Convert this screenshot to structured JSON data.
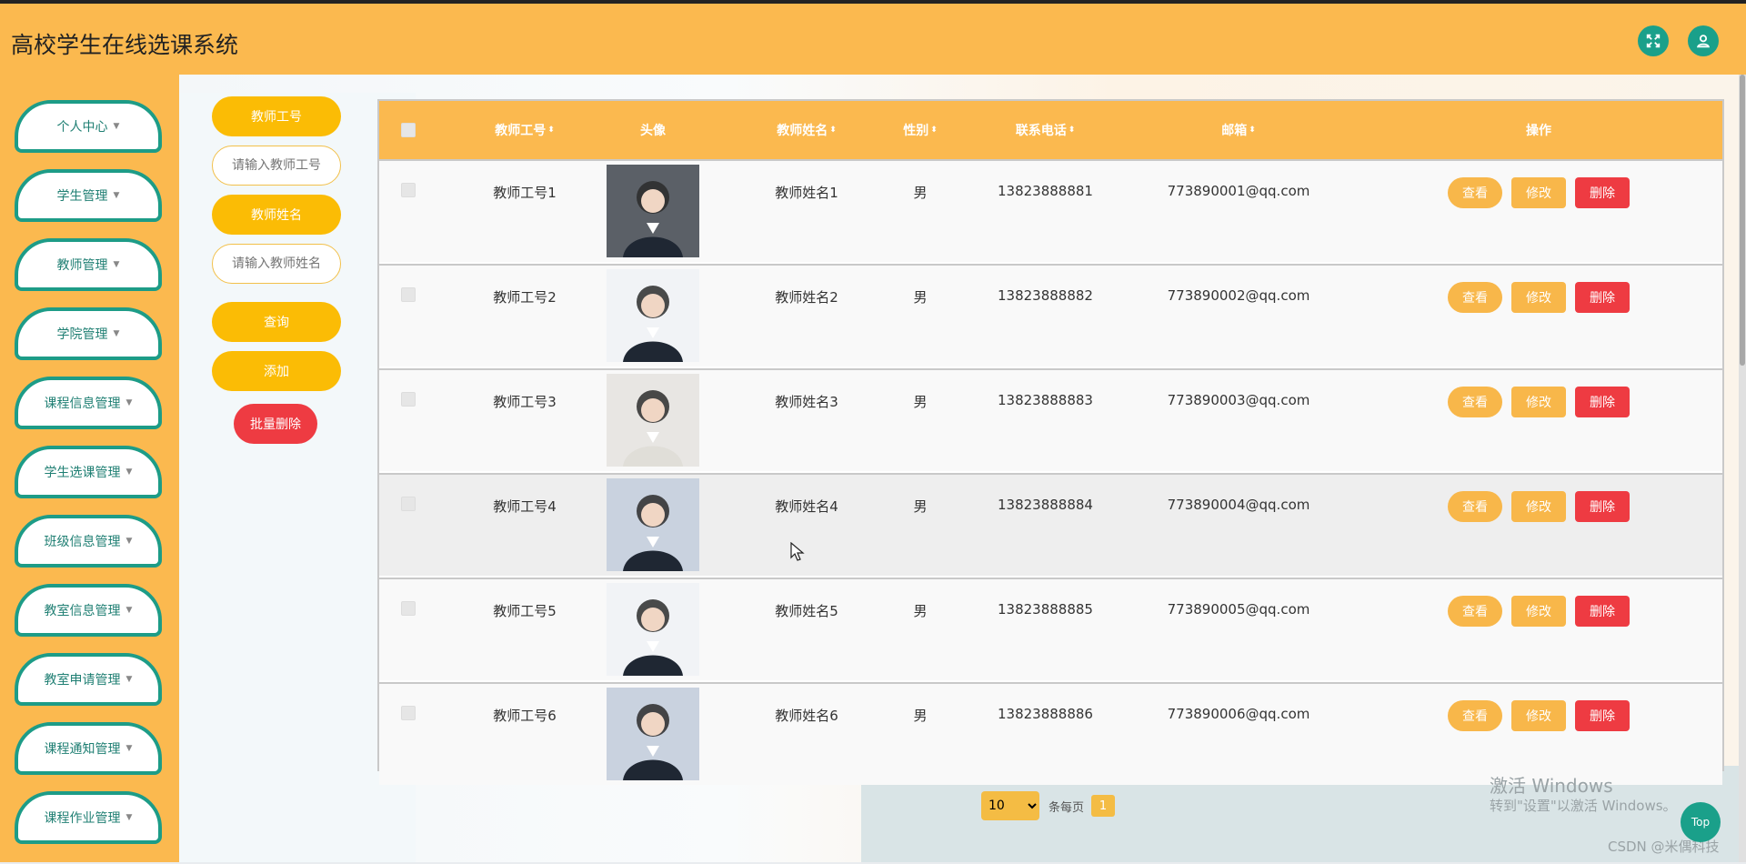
{
  "header": {
    "title": "高校学生在线选课系统",
    "fullscreen_icon": "expand-icon",
    "user_icon": "user-icon"
  },
  "sidebar": {
    "items": [
      {
        "label": "个人中心"
      },
      {
        "label": "学生管理"
      },
      {
        "label": "教师管理"
      },
      {
        "label": "学院管理"
      },
      {
        "label": "课程信息管理"
      },
      {
        "label": "学生选课管理"
      },
      {
        "label": "班级信息管理"
      },
      {
        "label": "教室信息管理"
      },
      {
        "label": "教室申请管理"
      },
      {
        "label": "课程通知管理"
      },
      {
        "label": "课程作业管理"
      }
    ]
  },
  "search": {
    "teacher_id_label": "教师工号",
    "teacher_id_placeholder": "请输入教师工号",
    "teacher_name_label": "教师姓名",
    "teacher_name_placeholder": "请输入教师姓名",
    "query_label": "查询",
    "add_label": "添加",
    "batch_delete_label": "批量删除"
  },
  "table": {
    "headers": {
      "id": "教师工号",
      "avatar": "头像",
      "name": "教师姓名",
      "gender": "性别",
      "phone": "联系电话",
      "email": "邮箱",
      "actions": "操作"
    },
    "actions": {
      "view": "查看",
      "edit": "修改",
      "delete": "删除"
    },
    "rows": [
      {
        "id": "教师工号1",
        "name": "教师姓名1",
        "gender": "男",
        "phone": "13823888881",
        "email": "773890001@qq.com"
      },
      {
        "id": "教师工号2",
        "name": "教师姓名2",
        "gender": "男",
        "phone": "13823888882",
        "email": "773890002@qq.com"
      },
      {
        "id": "教师工号3",
        "name": "教师姓名3",
        "gender": "男",
        "phone": "13823888883",
        "email": "773890003@qq.com"
      },
      {
        "id": "教师工号4",
        "name": "教师姓名4",
        "gender": "男",
        "phone": "13823888884",
        "email": "773890004@qq.com"
      },
      {
        "id": "教师工号5",
        "name": "教师姓名5",
        "gender": "男",
        "phone": "13823888885",
        "email": "773890005@qq.com"
      },
      {
        "id": "教师工号6",
        "name": "教师姓名6",
        "gender": "男",
        "phone": "13823888886",
        "email": "773890006@qq.com"
      }
    ]
  },
  "pager": {
    "page_size": "10",
    "per_page_label": "条每页",
    "current_page": "1"
  },
  "overlay": {
    "activate_windows": "激活 Windows",
    "activate_hint": "转到\"设置\"以激活 Windows。",
    "csdn": "CSDN @米偶科技",
    "top_label": "Top"
  },
  "colors": {
    "header": "#fbb94f",
    "accent": "#1aa08a",
    "button": "#fbbc05",
    "danger": "#ee3b42"
  }
}
